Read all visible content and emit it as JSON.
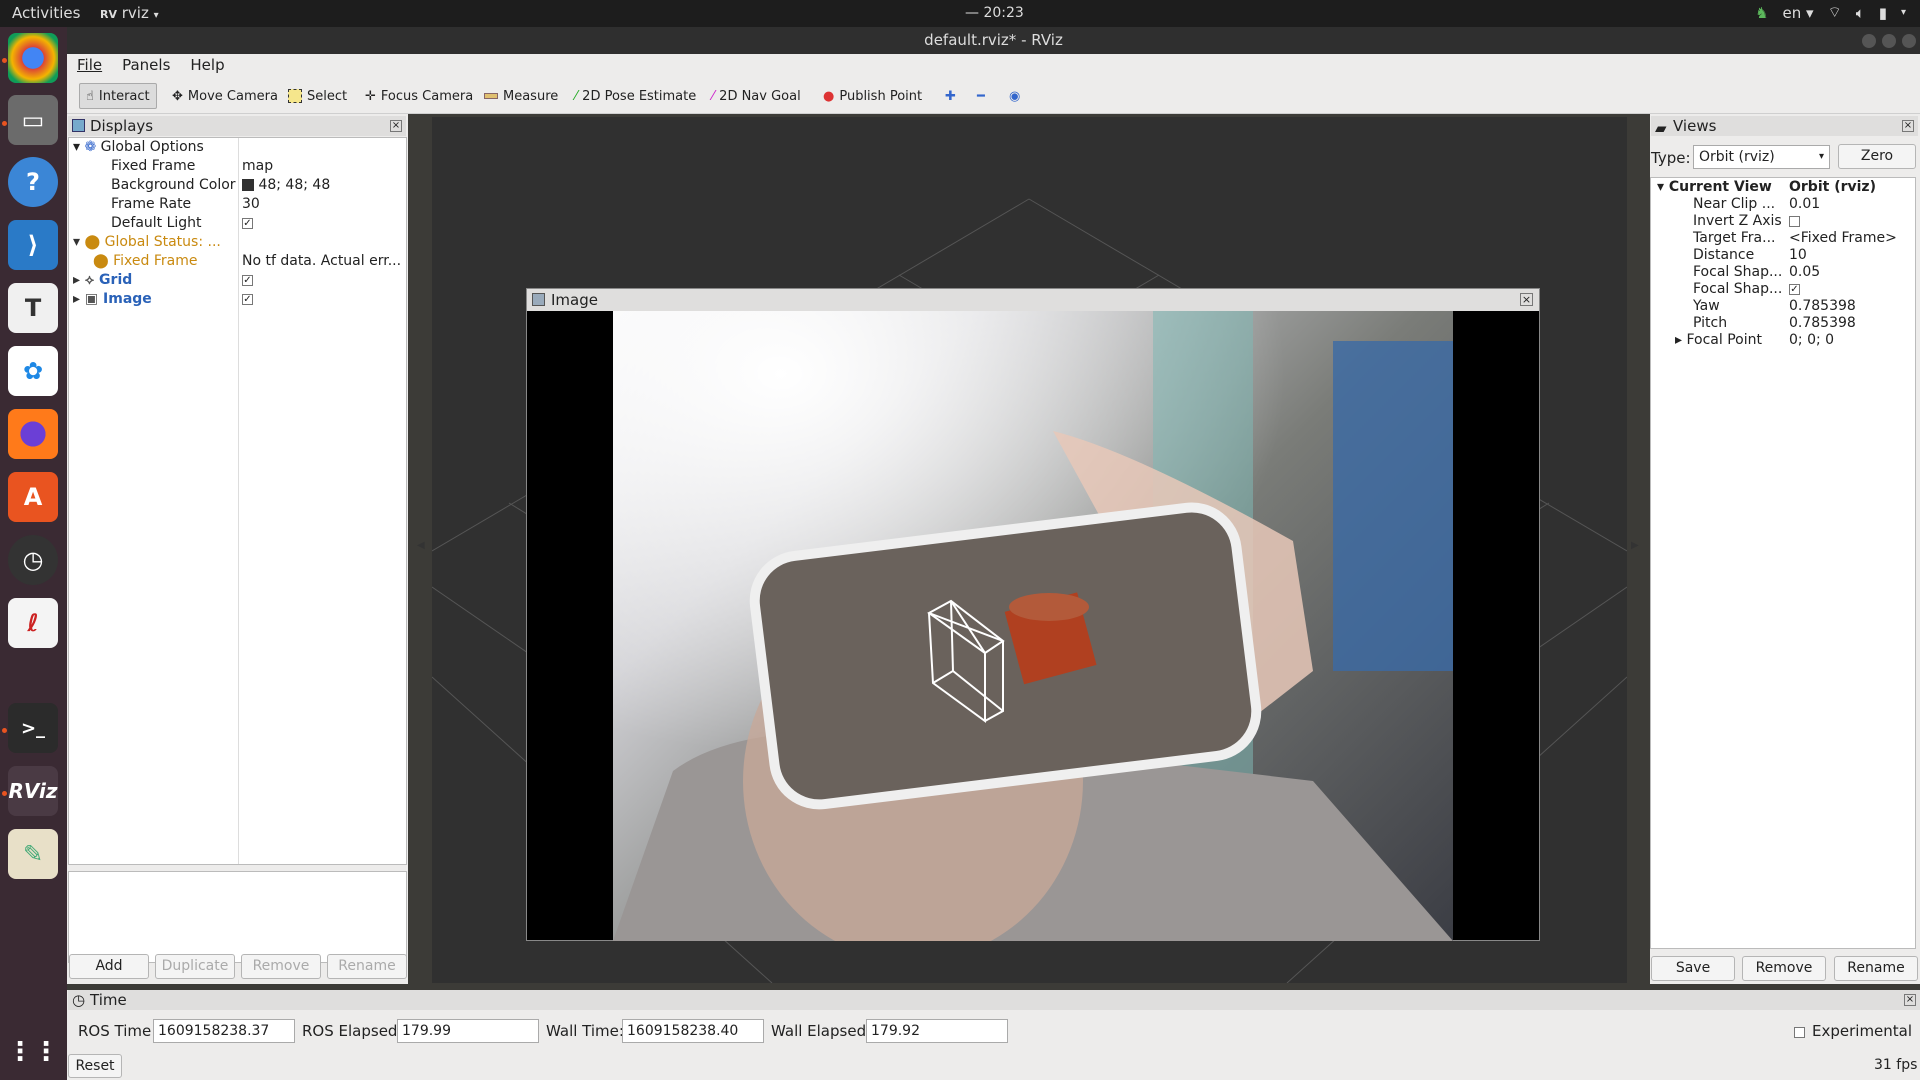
{
  "topbar": {
    "activities": "Activities",
    "app_name": "rviz",
    "clock": "— 20:23",
    "language": "en"
  },
  "window": {
    "title": "default.rviz* - RViz"
  },
  "menubar": {
    "file": "File",
    "panels": "Panels",
    "help": "Help"
  },
  "toolbar": {
    "interact": "Interact",
    "move_camera": "Move Camera",
    "select": "Select",
    "focus_camera": "Focus Camera",
    "measure": "Measure",
    "pose_estimate": "2D Pose Estimate",
    "nav_goal": "2D Nav Goal",
    "publish_point": "Publish Point"
  },
  "displays": {
    "title": "Displays",
    "global_options": "Global Options",
    "fixed_frame_label": "Fixed Frame",
    "fixed_frame_value": "map",
    "bg_color_label": "Background Color",
    "bg_color_value": "48; 48; 48",
    "frame_rate_label": "Frame Rate",
    "frame_rate_value": "30",
    "default_light_label": "Default Light",
    "global_status": "Global Status: ...",
    "status_fixed_frame": "Fixed Frame",
    "status_error": "No tf data.  Actual err...",
    "grid": "Grid",
    "image": "Image",
    "buttons": {
      "add": "Add",
      "duplicate": "Duplicate",
      "remove": "Remove",
      "rename": "Rename"
    }
  },
  "image_panel": {
    "title": "Image"
  },
  "views": {
    "title": "Views",
    "type_label": "Type:",
    "type_value": "Orbit (rviz)",
    "zero": "Zero",
    "current_view": "Current View",
    "current_view_value": "Orbit (rviz)",
    "props": [
      {
        "label": "Near Clip ...",
        "value": "0.01"
      },
      {
        "label": "Invert Z Axis",
        "value": ""
      },
      {
        "label": "Target Fra...",
        "value": "<Fixed Frame>"
      },
      {
        "label": "Distance",
        "value": "10"
      },
      {
        "label": "Focal Shap...",
        "value": "0.05"
      },
      {
        "label": "Focal Shap...",
        "value": ""
      },
      {
        "label": "Yaw",
        "value": "0.785398"
      },
      {
        "label": "Pitch",
        "value": "0.785398"
      },
      {
        "label": "Focal Point",
        "value": "0; 0; 0"
      }
    ],
    "buttons": {
      "save": "Save",
      "remove": "Remove",
      "rename": "Rename"
    }
  },
  "time": {
    "title": "Time",
    "ros_time_label": "ROS Time:",
    "ros_time": "1609158238.37",
    "ros_elapsed_label": "ROS Elapsed:",
    "ros_elapsed": "179.99",
    "wall_time_label": "Wall Time:",
    "wall_time": "1609158238.40",
    "wall_elapsed_label": "Wall Elapsed:",
    "wall_elapsed": "179.92",
    "experimental": "Experimental",
    "reset": "Reset",
    "fps": "31 fps"
  },
  "colors": {
    "accent": "#e95420",
    "viewport_bg": "#303030",
    "warning": "#e8a317",
    "link": "#2a62b8"
  }
}
